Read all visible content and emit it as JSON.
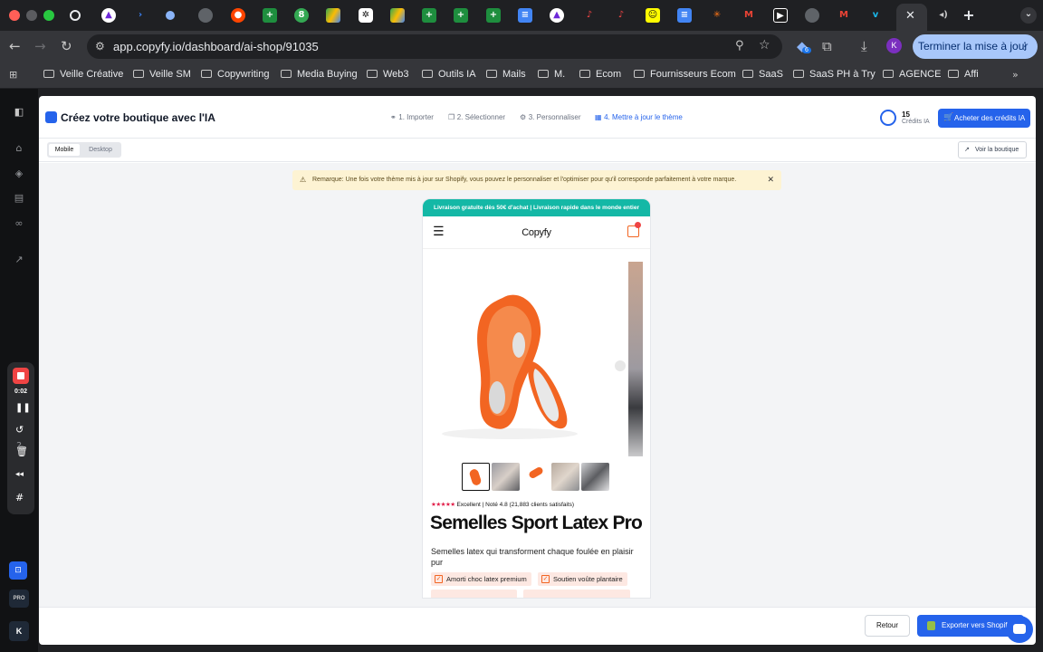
{
  "browser": {
    "url": "app.copyfy.io/dashboard/ai-shop/91035",
    "update_button": "Terminer la mise à jour",
    "extension_badge": "6",
    "profile_initial": "K",
    "bookmarks": [
      "Veille Créative",
      "Veille SM",
      "Copywriting",
      "Media Buying",
      "Web3",
      "Outils IA",
      "Mails",
      "M.",
      "Ecom",
      "Fournisseurs Ecom",
      "SaaS",
      "SaaS PH à Try",
      "AGENCE",
      "Affi"
    ]
  },
  "recorder": {
    "time": "0:02"
  },
  "rail": {
    "pro_label": "PRO",
    "user_initial": "K"
  },
  "header": {
    "title": "Créez votre boutique avec l'IA",
    "steps": [
      "1. Importer",
      "2. Sélectionner",
      "3. Personnaliser",
      "4. Mettre à jour le thème"
    ],
    "credits_value": "15",
    "credits_label": "Crédits IA",
    "buy_credits": "Acheter des crédits IA"
  },
  "toolbar": {
    "view_mobile": "Mobile",
    "view_desktop": "Desktop",
    "view_store": "Voir la boutique"
  },
  "notice": {
    "text": "Remarque: Une fois votre thème mis à jour sur Shopify, vous pouvez le personnaliser et l'optimiser pour qu'il corresponde parfaitement à votre marque."
  },
  "store": {
    "promo": "Livraison gratuite dès 50€ d'achat | Livraison rapide dans le monde entier",
    "brand": "Copyfy",
    "cart_count": "",
    "rating_stars": "★★★★★",
    "rating_text": "Excellent | Noté 4.8 (21,883 clients satisfaits)",
    "product_title": "Semelles Sport Latex Pro",
    "product_description": "Semelles latex qui transforment chaque foulée en plaisir pur",
    "features": [
      "Amorti choc latex premium",
      "Soutien voûte plantaire"
    ]
  },
  "footer": {
    "back": "Retour",
    "export": "Exporter vers Shopify"
  },
  "colors": {
    "accent": "#2563eb",
    "promo_bar": "#14b8a6",
    "product_orange": "#f26522",
    "rating_red": "#e11d48"
  }
}
